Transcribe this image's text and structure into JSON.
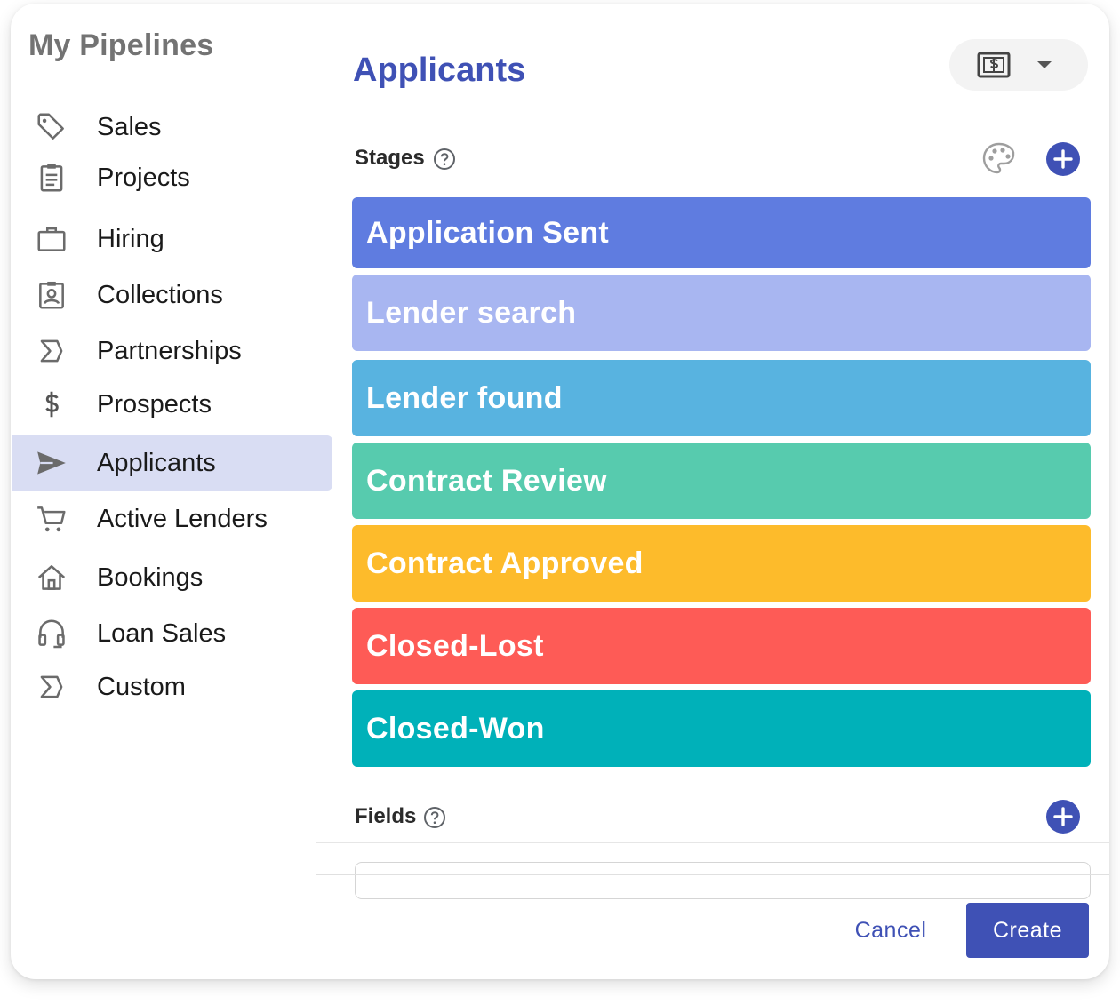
{
  "sidebar": {
    "title": "My Pipelines",
    "items": [
      {
        "label": "Sales",
        "icon": "tag-icon"
      },
      {
        "label": "Projects",
        "icon": "clipboard-icon"
      },
      {
        "label": "Hiring",
        "icon": "briefcase-icon"
      },
      {
        "label": "Collections",
        "icon": "badge-icon"
      },
      {
        "label": "Partnerships",
        "icon": "sigma-icon"
      },
      {
        "label": "Prospects",
        "icon": "dollar-icon"
      },
      {
        "label": "Applicants",
        "icon": "send-icon",
        "active": true
      },
      {
        "label": "Active Lenders",
        "icon": "cart-icon"
      },
      {
        "label": "Bookings",
        "icon": "home-icon"
      },
      {
        "label": "Loan Sales",
        "icon": "headset-icon"
      },
      {
        "label": "Custom",
        "icon": "sigma-icon"
      }
    ]
  },
  "main": {
    "title": "Applicants",
    "currency_icon": "money-icon",
    "stages_label": "Stages",
    "fields_label": "Fields",
    "stages": [
      {
        "label": "Application Sent",
        "color": "#5f7ce0"
      },
      {
        "label": "Lender search",
        "color": "#a8b6f1"
      },
      {
        "label": "Lender found",
        "color": "#58b3e0"
      },
      {
        "label": "Contract Review",
        "color": "#57cbae"
      },
      {
        "label": "Contract Approved",
        "color": "#fdbb2b"
      },
      {
        "label": "Closed-Lost",
        "color": "#fe5b56"
      },
      {
        "label": "Closed-Won",
        "color": "#00b1b9"
      }
    ]
  },
  "footer": {
    "cancel_label": "Cancel",
    "create_label": "Create"
  },
  "colors": {
    "accent": "#3f51b5",
    "active_item_bg": "#d9ddf3"
  }
}
